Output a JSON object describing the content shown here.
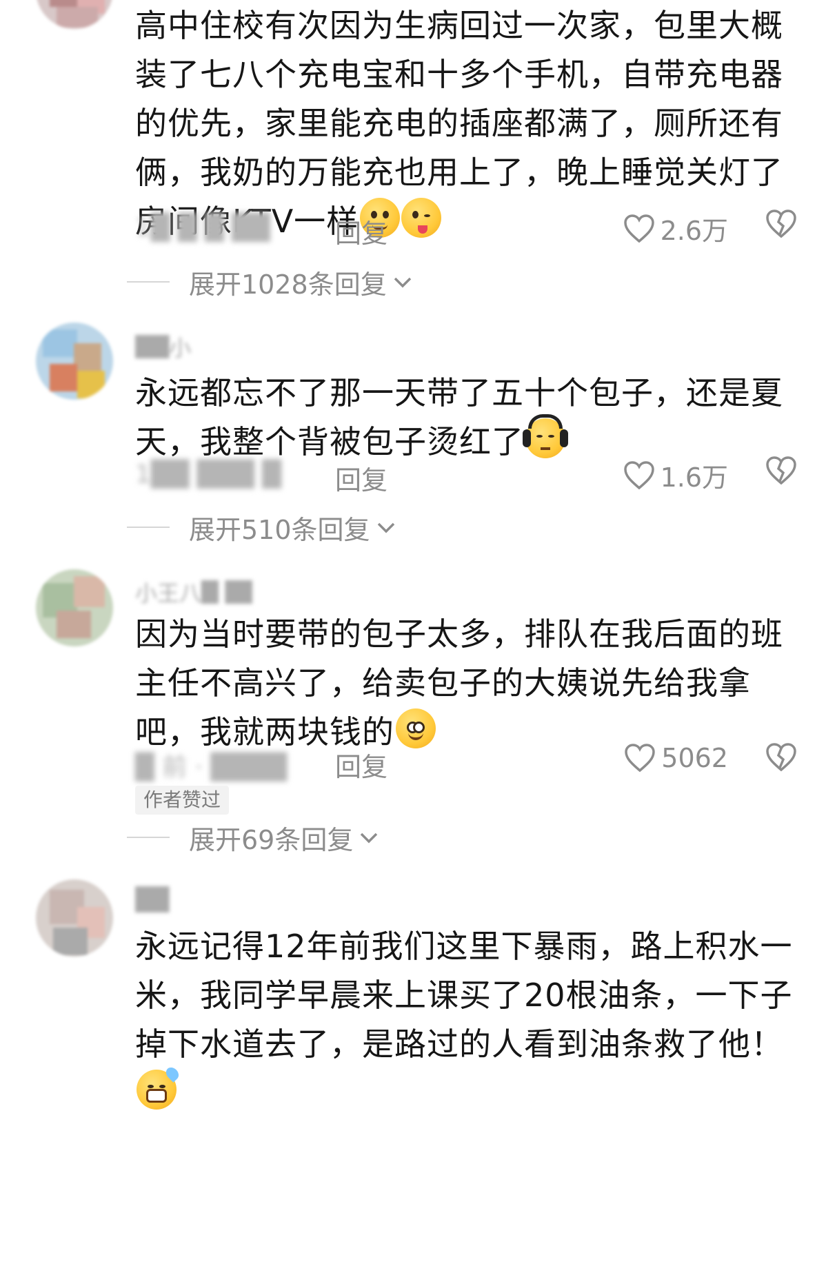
{
  "comments": [
    {
      "username": "",
      "text": "高中住校有次因为生病回过一次家，包里大概装了七八个充电宝和十多个手机，自带充电器的优先，家里能充电的插座都满了，厕所还有俩，我奶的万能充也用上了，晚上睡觉关灯了房间像KTV一样",
      "emojis": [
        "pleading-face-emoji",
        "winking-tongue-emoji"
      ],
      "time": "1█ █ █ ██",
      "reply_label": "回复",
      "likes": "2.6万",
      "expand_label": "展开1028条回复"
    },
    {
      "username": "██小",
      "text": "永远都忘不了那一天带了五十个包子，还是夏天，我整个背被包子烫红了",
      "emojis": [
        "headphones-face-emoji"
      ],
      "time": "1██ ███ █",
      "reply_label": "回复",
      "likes": "1.6万",
      "expand_label": "展开510条回复"
    },
    {
      "username": "小王八█ ██",
      "text": "因为当时要带的包子太多，排队在我后面的班主任不高兴了，给卖包子的大姨说先给我拿吧，我就两块钱的",
      "emojis": [
        "smiling-face-emoji"
      ],
      "time": "█ 前 · ████",
      "reply_label": "回复",
      "likes": "5062",
      "badge": "作者赞过",
      "expand_label": "展开69条回复"
    },
    {
      "username": "██",
      "text": "永远记得12年前我们这里下暴雨，路上积水一米，我同学早晨来上课买了20根油条，一下子掉下水道去了，是路过的人看到油条救了他！",
      "emojis": [
        "grinning-sweat-emoji"
      ]
    }
  ]
}
